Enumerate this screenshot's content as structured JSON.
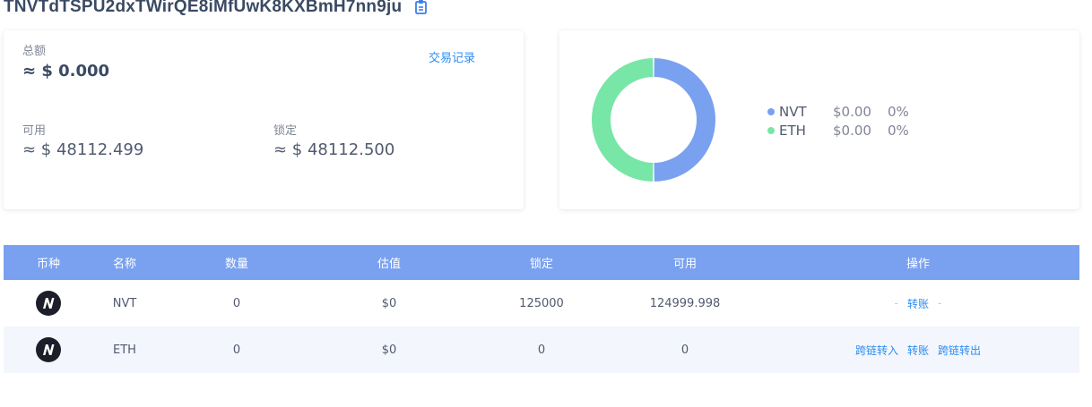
{
  "address": "TNVTdTSPU2dxTWirQE8iMfUwK8KXBmH7nn9ju",
  "summary": {
    "total_label": "总额",
    "total_value": "≈ $ 0.000",
    "tx_link": "交易记录",
    "available_label": "可用",
    "available_value": "≈ $ 48112.499",
    "locked_label": "锁定",
    "locked_value": "≈ $ 48112.500"
  },
  "chart_data": {
    "type": "pie",
    "labels": [
      "NVT",
      "ETH"
    ],
    "values": [
      50,
      50
    ],
    "colors": [
      "#7aa1ef",
      "#77e6a7"
    ]
  },
  "legend": [
    {
      "name": "NVT",
      "value": "$0.00",
      "pct": "0%",
      "color": "#7aa1ef"
    },
    {
      "name": "ETH",
      "value": "$0.00",
      "pct": "0%",
      "color": "#77e6a7"
    }
  ],
  "table": {
    "headers": [
      "币种",
      "名称",
      "数量",
      "估值",
      "锁定",
      "可用",
      "操作"
    ],
    "rows": [
      {
        "name": "NVT",
        "amount": "0",
        "valuation": "$0",
        "locked": "125000",
        "available": "124999.998",
        "actions": {
          "left": "-",
          "middle": "转账",
          "right": "-"
        }
      },
      {
        "name": "ETH",
        "amount": "0",
        "valuation": "$0",
        "locked": "0",
        "available": "0",
        "actions": {
          "left": "跨链转入",
          "middle": "转账",
          "right": "跨链转出"
        }
      }
    ]
  },
  "colors": {
    "accent": "#2d8cf0",
    "header_bg": "#7aa1ef"
  }
}
